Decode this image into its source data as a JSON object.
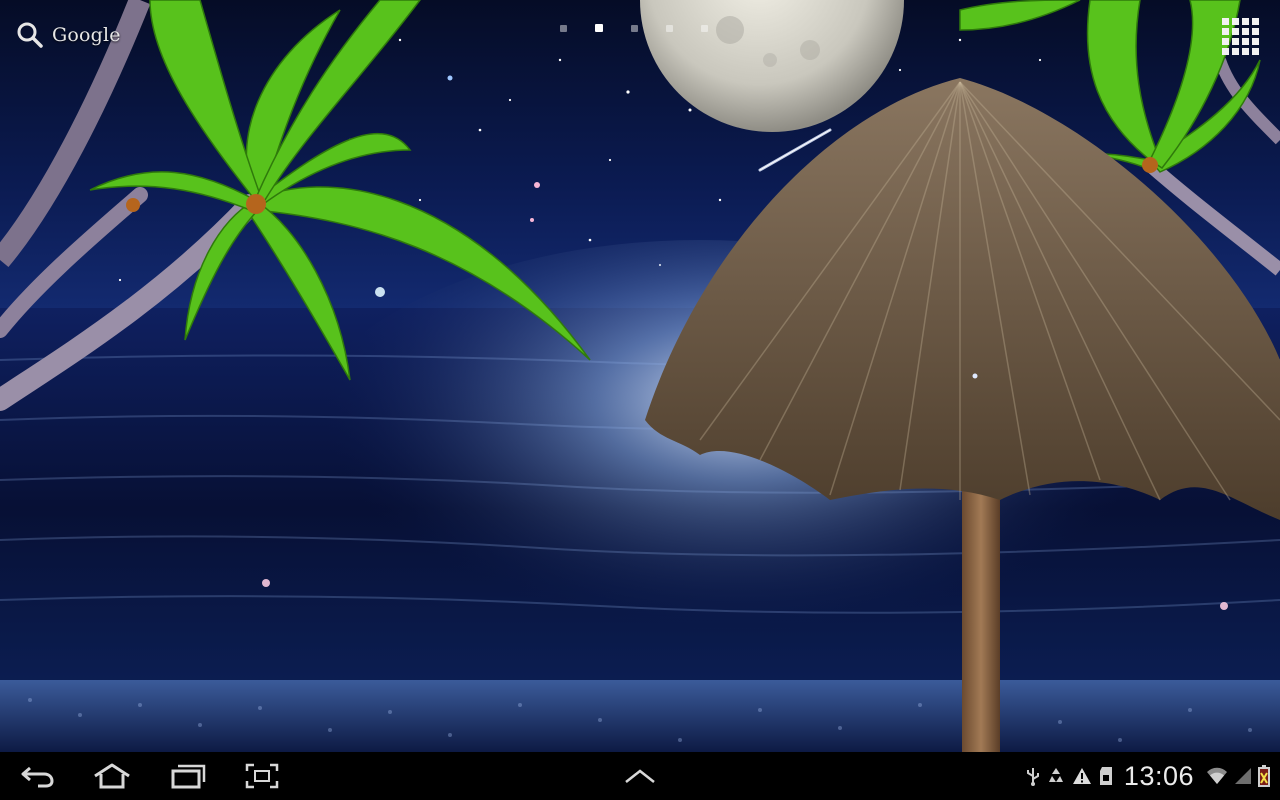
{
  "search": {
    "label": "Google",
    "icon": "search-icon"
  },
  "home_pages": {
    "count": 5,
    "active_index": 1
  },
  "apps_button": {
    "icon": "app-grid-icon"
  },
  "wallpaper": {
    "description_colors": {
      "sky": "#0a1433",
      "sea": "#0d1a44",
      "moonlight": "#c9d6f2",
      "palm_leaves": "#56c11d",
      "thatch": "#6e5a44"
    }
  },
  "navigation": {
    "back_icon": "back-icon",
    "home_icon": "home-icon",
    "recents_icon": "recent-apps-icon",
    "screenshot_icon": "screen-capture-icon",
    "menu_icon": "chevron-up-icon"
  },
  "status_bar": {
    "time": "13:06",
    "icons": [
      "usb-icon",
      "recycle-icon",
      "warning-icon",
      "sd-card-icon",
      "wifi-icon",
      "signal-icon",
      "battery-icon"
    ]
  }
}
